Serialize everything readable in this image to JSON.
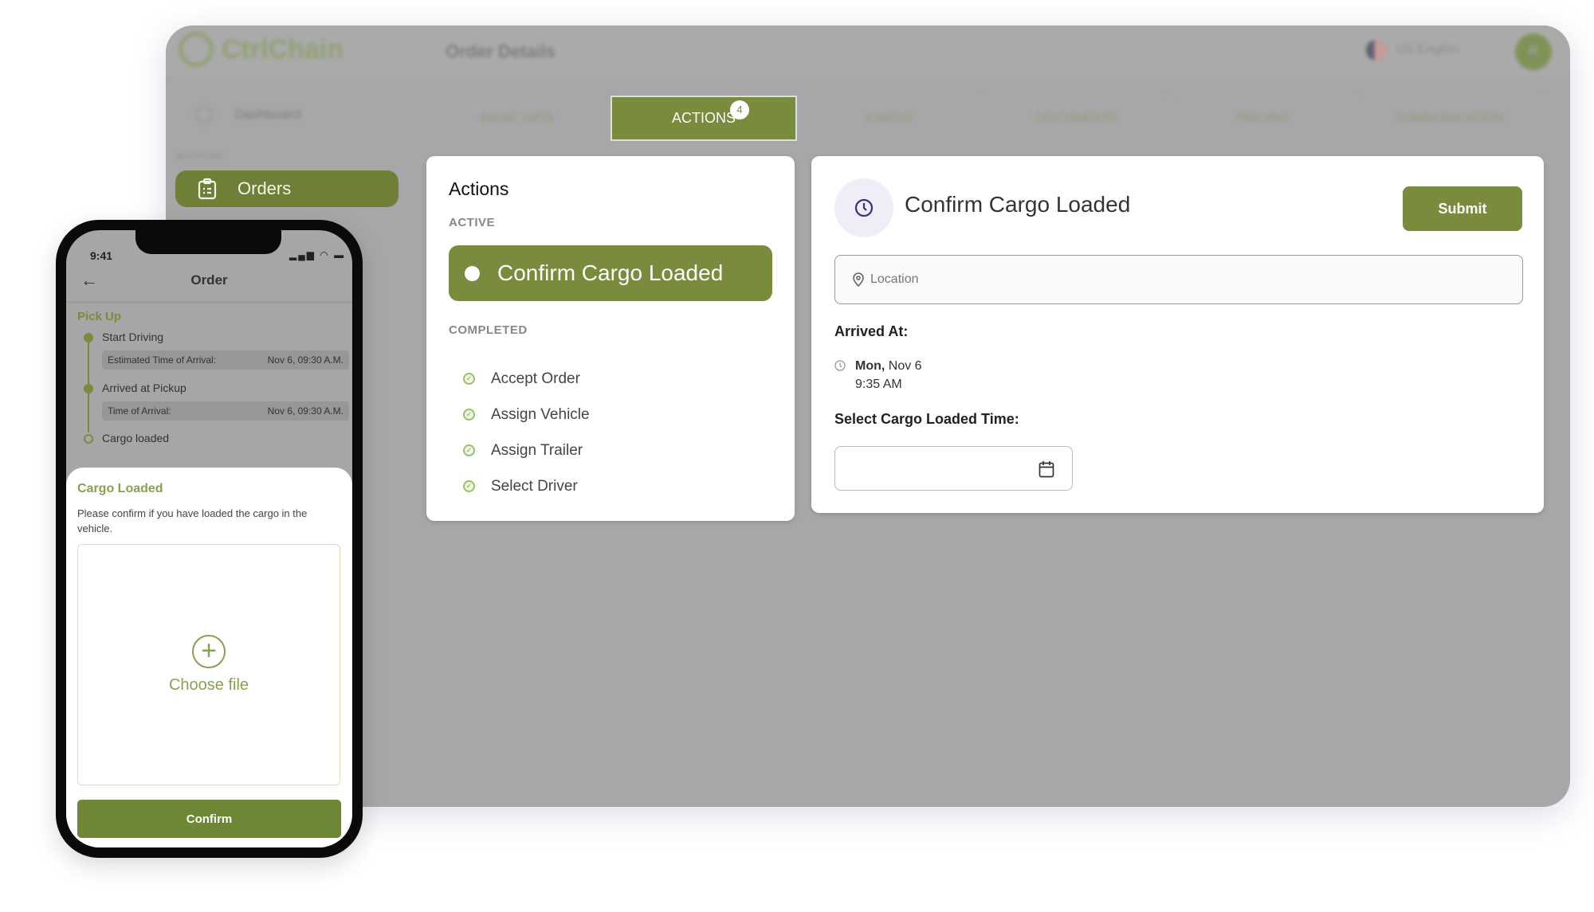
{
  "app": {
    "name": "CtrlChain",
    "page_title": "Order Details",
    "language": "US English",
    "avatar_initial": "R",
    "accent": "#798b3d"
  },
  "sidebar": {
    "dashboard": "Dashboard",
    "section": "BOOKING",
    "orders": "Orders"
  },
  "tabs": [
    {
      "label": "BASIC INFO"
    },
    {
      "label": "ACTIONS",
      "badge": "4",
      "active": true
    },
    {
      "label": "CARGO"
    },
    {
      "label": "DOCUMENTS"
    },
    {
      "label": "PRICING"
    },
    {
      "label": "COMMUNICATION"
    }
  ],
  "actions": {
    "title": "Actions",
    "active_label": "ACTIVE",
    "active_item": "Confirm Cargo Loaded",
    "completed_label": "COMPLETED",
    "completed": [
      "Accept Order",
      "Assign Vehicle",
      "Assign Trailer",
      "Select Driver"
    ]
  },
  "detail": {
    "title": "Confirm Cargo Loaded",
    "submit": "Submit",
    "location_placeholder": "Location",
    "arrived_label": "Arrived At:",
    "arrived_day": "Mon,",
    "arrived_date": " Nov 6",
    "arrived_time": "9:35 AM",
    "cargo_time_label": "Select Cargo Loaded Time:",
    "cargo_time_value": ""
  },
  "phone": {
    "time": "9:41",
    "title": "Order",
    "section": "Pick Up",
    "steps": [
      {
        "label": "Start Driving",
        "info_label": "Estimated Time of Arrival:",
        "info_value": "Nov 6, 09:30 A.M."
      },
      {
        "label": "Arrived at Pickup",
        "info_label": "Time of Arrival:",
        "info_value": "Nov 6, 09:30 A.M."
      },
      {
        "label": "Cargo loaded"
      }
    ],
    "sheet": {
      "title": "Cargo Loaded",
      "description": "Please confirm if you have loaded the cargo in the vehicle.",
      "upload": "Choose file",
      "confirm": "Confirm"
    }
  }
}
